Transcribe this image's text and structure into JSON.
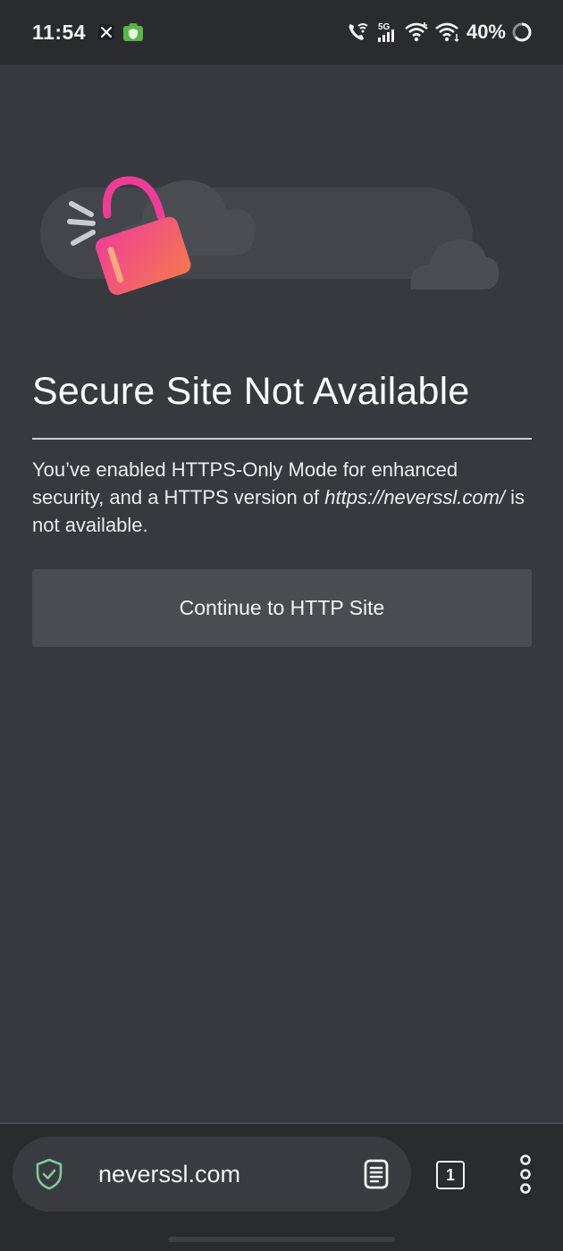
{
  "status_bar": {
    "time": "11:54",
    "battery": "40%",
    "icons": [
      "x-icon",
      "vpn-shield-icon",
      "wifi-calling-icon",
      "5g-signal-icon",
      "wifi-icon",
      "wifi-secondary-icon",
      "battery-ring-icon"
    ]
  },
  "page": {
    "title": "Secure Site Not Available",
    "message_before": "You’ve enabled HTTPS-Only Mode for enhanced security, and a HTTPS version of ",
    "message_url": "https://neverssl.com/",
    "message_after": " is not available.",
    "continue_button": "Continue to HTTP Site",
    "illustration": "unlocked-padlock-clouds-illustration"
  },
  "toolbar": {
    "url": "neverssl.com",
    "tab_count": "1",
    "security_icon": "shield-check-icon",
    "reader_icon": "reader-view-icon",
    "menu_icon": "three-dot-menu-icon"
  },
  "colors": {
    "background": "#38393f",
    "bar_background": "#2a2b2f",
    "button": "#4b4c52",
    "shield_accent": "#7fc99a",
    "padlock_pink": "#ee3d96",
    "padlock_orange": "#f4784f"
  }
}
